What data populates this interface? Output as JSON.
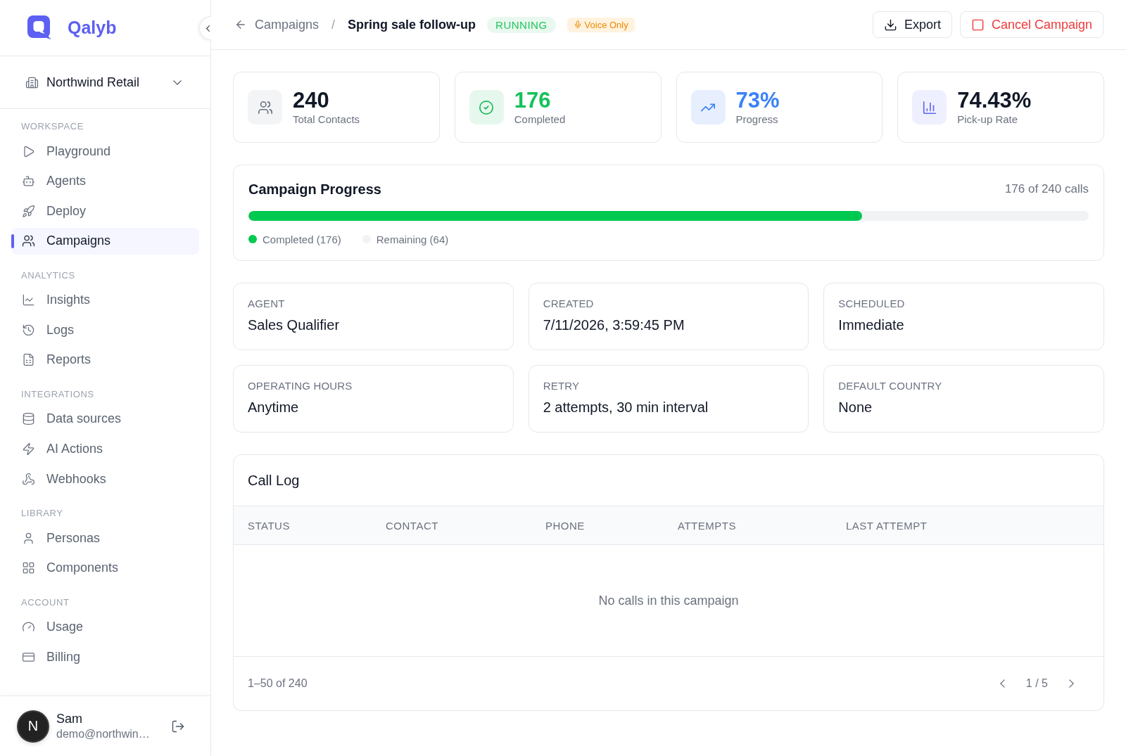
{
  "sidebar": {
    "brand": "Qalyb",
    "workspace": "Northwind Retail",
    "sections": [
      {
        "title": "WORKSPACE",
        "items": [
          {
            "label": "Playground",
            "selected": false
          },
          {
            "label": "Agents",
            "selected": false
          },
          {
            "label": "Deploy",
            "selected": false
          },
          {
            "label": "Campaigns",
            "selected": true
          }
        ]
      },
      {
        "title": "ANALYTICS",
        "items": [
          {
            "label": "Insights",
            "selected": false
          },
          {
            "label": "Logs",
            "selected": false
          },
          {
            "label": "Reports",
            "selected": false
          }
        ]
      },
      {
        "title": "INTEGRATIONS",
        "items": [
          {
            "label": "Data sources",
            "selected": false
          },
          {
            "label": "AI Actions",
            "selected": false
          },
          {
            "label": "Webhooks",
            "selected": false
          }
        ]
      },
      {
        "title": "LIBRARY",
        "items": [
          {
            "label": "Personas",
            "selected": false
          },
          {
            "label": "Components",
            "selected": false
          }
        ]
      },
      {
        "title": "ACCOUNT",
        "items": [
          {
            "label": "Usage",
            "selected": false
          },
          {
            "label": "Billing",
            "selected": false
          }
        ]
      }
    ],
    "user": {
      "avatar_initial": "N",
      "name": "Sam",
      "email": "demo@northwin…"
    }
  },
  "header": {
    "breadcrumb_parent": "Campaigns",
    "separator": "/",
    "title": "Spring sale follow-up",
    "status": {
      "label": "RUNNING",
      "kind": "running"
    },
    "channel": {
      "label": "Voice Only"
    },
    "buttons": [
      {
        "label": "Export",
        "kind": "export"
      },
      {
        "label": "Cancel Campaign",
        "kind": "cancel"
      }
    ]
  },
  "stats": [
    {
      "value": "240",
      "label": "Total Contacts",
      "kind": "neutral"
    },
    {
      "value": "176",
      "label": "Completed",
      "kind": "success"
    },
    {
      "value": "73%",
      "label": "Progress",
      "kind": "info"
    },
    {
      "value": "74.43%",
      "label": "Pick-up Rate",
      "kind": "accent"
    }
  ],
  "progress": {
    "title": "Campaign Progress",
    "summary": "176 of 240 calls",
    "level": 0.73,
    "legend": [
      {
        "label": "Completed (176)",
        "color": "#00c951"
      },
      {
        "label": "Remaining (64)",
        "color": "#f1f2f4"
      }
    ]
  },
  "details": [
    {
      "label": "AGENT",
      "value": "Sales Qualifier"
    },
    {
      "label": "CREATED",
      "value": "7/11/2026, 3:59:45 PM"
    },
    {
      "label": "SCHEDULED",
      "value": "Immediate"
    },
    {
      "label": "OPERATING HOURS",
      "value": "Anytime"
    },
    {
      "label": "RETRY",
      "value": "2 attempts, 30 min interval"
    },
    {
      "label": "DEFAULT COUNTRY",
      "value": "None"
    }
  ],
  "call_log": {
    "title": "Call Log",
    "columns": [
      "STATUS",
      "CONTACT",
      "PHONE",
      "ATTEMPTS",
      "LAST ATTEMPT"
    ],
    "empty_message": "No calls in this campaign",
    "range": "1–50 of 240",
    "page": "1 / 5"
  }
}
